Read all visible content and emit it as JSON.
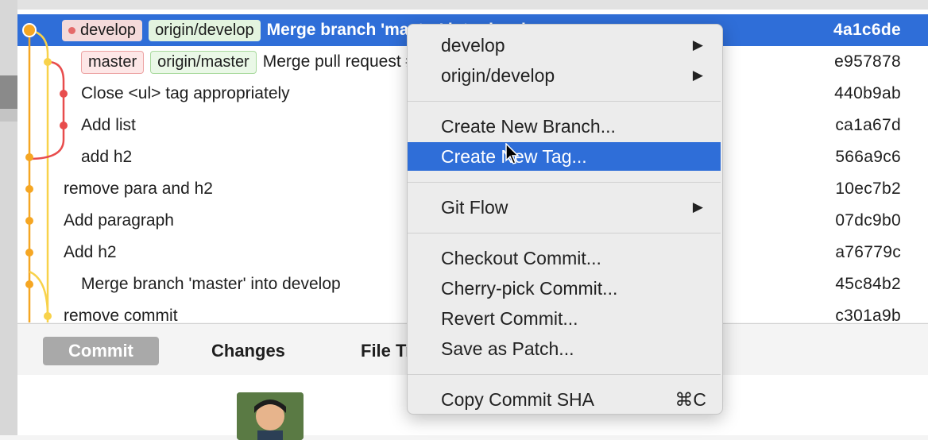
{
  "commits": [
    {
      "refs": [
        {
          "label": "develop",
          "style": "sel-red",
          "head": true
        },
        {
          "label": "origin/develop",
          "style": "sel-green"
        }
      ],
      "message": "Merge branch 'master' into develop",
      "sha": "4a1c6de",
      "selected": true
    },
    {
      "refs": [
        {
          "label": "master",
          "style": "red"
        },
        {
          "label": "origin/master",
          "style": "green"
        }
      ],
      "message": "Merge pull request #1 from feature/list",
      "sha": "e957878"
    },
    {
      "refs": [],
      "message": "Close <ul> tag appropriately",
      "sha": "440b9ab"
    },
    {
      "refs": [],
      "message": "Add list",
      "sha": "ca1a67d"
    },
    {
      "refs": [],
      "message": "add h2",
      "sha": "566a9c6"
    },
    {
      "refs": [],
      "message": "remove para and h2",
      "sha": "10ec7b2"
    },
    {
      "refs": [],
      "message": "Add paragraph",
      "sha": "07dc9b0"
    },
    {
      "refs": [],
      "message": "Add h2",
      "sha": "a76779c"
    },
    {
      "refs": [],
      "message": "Merge branch 'master' into develop",
      "sha": "45c84b2"
    },
    {
      "refs": [],
      "message": "remove commit",
      "sha": "c301a9b"
    }
  ],
  "tabs": [
    {
      "label": "Commit",
      "active": true
    },
    {
      "label": "Changes"
    },
    {
      "label": "File Tree"
    }
  ],
  "context_menu": {
    "items": [
      {
        "label": "develop",
        "submenu": true
      },
      {
        "label": "origin/develop",
        "submenu": true
      },
      {
        "separator": true
      },
      {
        "label": "Create New Branch..."
      },
      {
        "label": "Create New Tag...",
        "highlighted": true
      },
      {
        "separator": true
      },
      {
        "label": "Git Flow",
        "submenu": true
      },
      {
        "separator": true
      },
      {
        "label": "Checkout Commit..."
      },
      {
        "label": "Cherry-pick Commit..."
      },
      {
        "label": "Revert Commit..."
      },
      {
        "label": "Save as Patch..."
      },
      {
        "separator": true
      },
      {
        "label": "Copy Commit SHA",
        "shortcut": "⌘C"
      }
    ]
  },
  "colors": {
    "selection": "#2f6ed8",
    "branch_develop": "#f5a623",
    "branch_master": "#f8d24a",
    "branch_feature": "#e84c4c"
  },
  "icons": {
    "submenu_arrow": "triangle-right",
    "cursor": "arrow-pointer"
  }
}
